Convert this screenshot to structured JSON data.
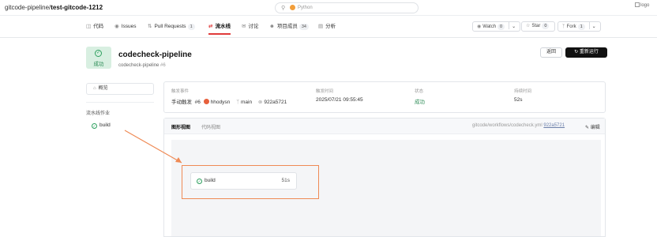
{
  "topbar": {
    "repo_owner": "gitcode-pipeline/",
    "repo_name": "test-gitcode-1212",
    "search_placeholder": "Python",
    "logo_alt": "logo"
  },
  "tabs": [
    {
      "label": "代码",
      "icon": "code-icon"
    },
    {
      "label": "Issues",
      "icon": "issues-icon"
    },
    {
      "label": "Pull Requests",
      "icon": "pull-request-icon",
      "count": "1"
    },
    {
      "label": "流水线",
      "icon": "pipeline-icon",
      "active": true
    },
    {
      "label": "讨论",
      "icon": "discussion-icon"
    },
    {
      "label": "项目成员",
      "icon": "members-icon",
      "count": "34"
    },
    {
      "label": "分析",
      "icon": "chart-icon"
    }
  ],
  "repo_actions": {
    "watch_label": "Watch",
    "watch_count": "0",
    "star_label": "Star",
    "star_count": "0",
    "fork_label": "Fork",
    "fork_count": "1"
  },
  "pipeline": {
    "status": "成功",
    "title": "codecheck-pipeline",
    "subtitle_name": "codecheck-pipeline",
    "subtitle_run": "#6",
    "back_label": "返回",
    "rerun_label": "重新运行"
  },
  "sidebar": {
    "overview_label": "概览",
    "jobs_header": "流水线作业",
    "jobs": [
      {
        "label": "build"
      }
    ]
  },
  "info": {
    "trigger_label": "触发事件",
    "trigger_type": "手动触发",
    "run_number": "#6",
    "user": "hhodysn",
    "branch": "main",
    "commit": "922a5721",
    "time_label": "触发时间",
    "time_value": "2025/07/21 09:55:45",
    "status_label": "状态",
    "status_value": "成功",
    "duration_label": "持续时间",
    "duration_value": "52s"
  },
  "graph": {
    "tab_graph": "图形视图",
    "tab_code": "代码视图",
    "path_prefix": "gitcode/workflows/codecheck.yml",
    "path_commit": "922a5721",
    "edit_label": "编辑",
    "node_label": "build",
    "node_time": "51s"
  },
  "colors": {
    "accent_red": "#e03b3b",
    "success_green": "#2ea05f",
    "annotation_orange": "#ef8a55"
  }
}
